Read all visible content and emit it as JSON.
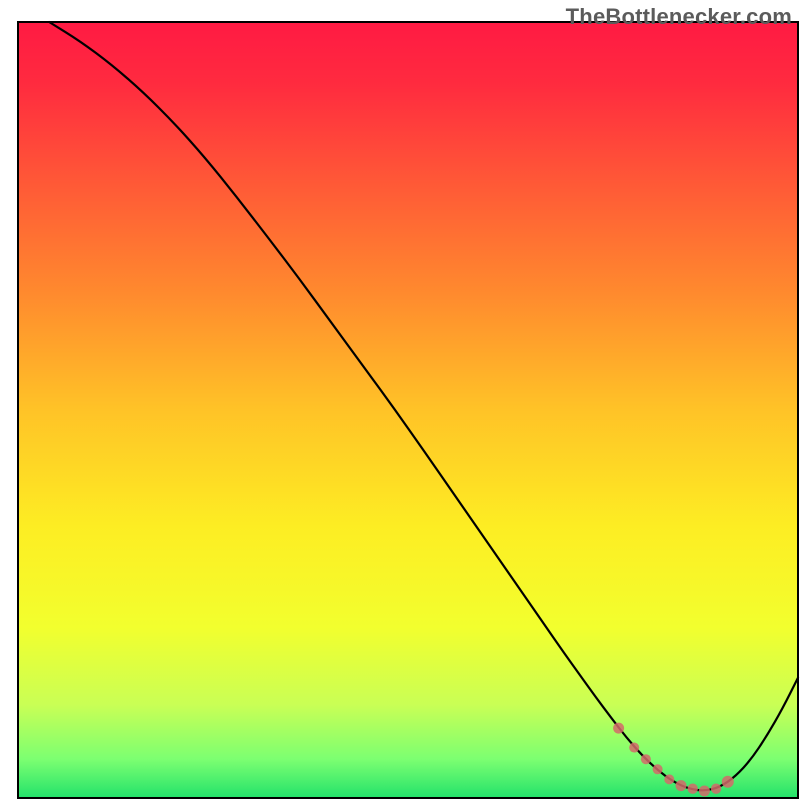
{
  "attribution": "TheBottlenecker.com",
  "chart_data": {
    "type": "line",
    "title": "",
    "xlabel": "",
    "ylabel": "",
    "xlim": [
      0,
      100
    ],
    "ylim": [
      0,
      100
    ],
    "axes_visible": false,
    "grid": false,
    "background": {
      "type": "vertical-gradient",
      "stops": [
        {
          "offset": 0.0,
          "color": "#ff1a43"
        },
        {
          "offset": 0.08,
          "color": "#ff2b3f"
        },
        {
          "offset": 0.2,
          "color": "#ff5637"
        },
        {
          "offset": 0.35,
          "color": "#ff8a2e"
        },
        {
          "offset": 0.5,
          "color": "#ffc327"
        },
        {
          "offset": 0.65,
          "color": "#fded23"
        },
        {
          "offset": 0.78,
          "color": "#f2ff2e"
        },
        {
          "offset": 0.88,
          "color": "#c9ff55"
        },
        {
          "offset": 0.95,
          "color": "#7cff71"
        },
        {
          "offset": 1.0,
          "color": "#23e26b"
        }
      ]
    },
    "series": [
      {
        "name": "bottleneck-curve",
        "color": "#000000",
        "stroke_width": 2.2,
        "x": [
          4,
          8,
          12,
          16,
          20,
          24,
          28,
          32,
          36,
          40,
          44,
          48,
          52,
          56,
          60,
          62,
          64,
          66,
          68,
          70,
          72,
          74,
          76,
          78,
          80,
          82,
          84,
          86,
          88,
          90,
          92,
          94,
          96,
          98,
          100
        ],
        "values": [
          100,
          97.5,
          94.5,
          91.0,
          87.0,
          82.5,
          77.5,
          72.3,
          67.0,
          61.5,
          56.0,
          50.5,
          44.8,
          39.0,
          33.2,
          30.3,
          27.4,
          24.5,
          21.6,
          18.7,
          15.9,
          13.1,
          10.4,
          7.8,
          5.5,
          3.6,
          2.1,
          1.2,
          0.9,
          1.4,
          2.8,
          5.0,
          8.0,
          11.5,
          15.5
        ]
      }
    ],
    "markers": {
      "name": "valley-markers",
      "color": "#d46a6a",
      "opacity": 0.85,
      "x": [
        77,
        79,
        80.5,
        82,
        83.5,
        85,
        86.5,
        88,
        89.5,
        91
      ],
      "values": [
        9.0,
        6.5,
        5.0,
        3.7,
        2.4,
        1.6,
        1.2,
        0.9,
        1.2,
        2.1
      ],
      "sizes": [
        5.5,
        5.0,
        5.0,
        5.0,
        5.0,
        5.5,
        5.2,
        5.5,
        5.2,
        6.0
      ]
    },
    "border": {
      "color": "#000000",
      "width": 2
    }
  }
}
